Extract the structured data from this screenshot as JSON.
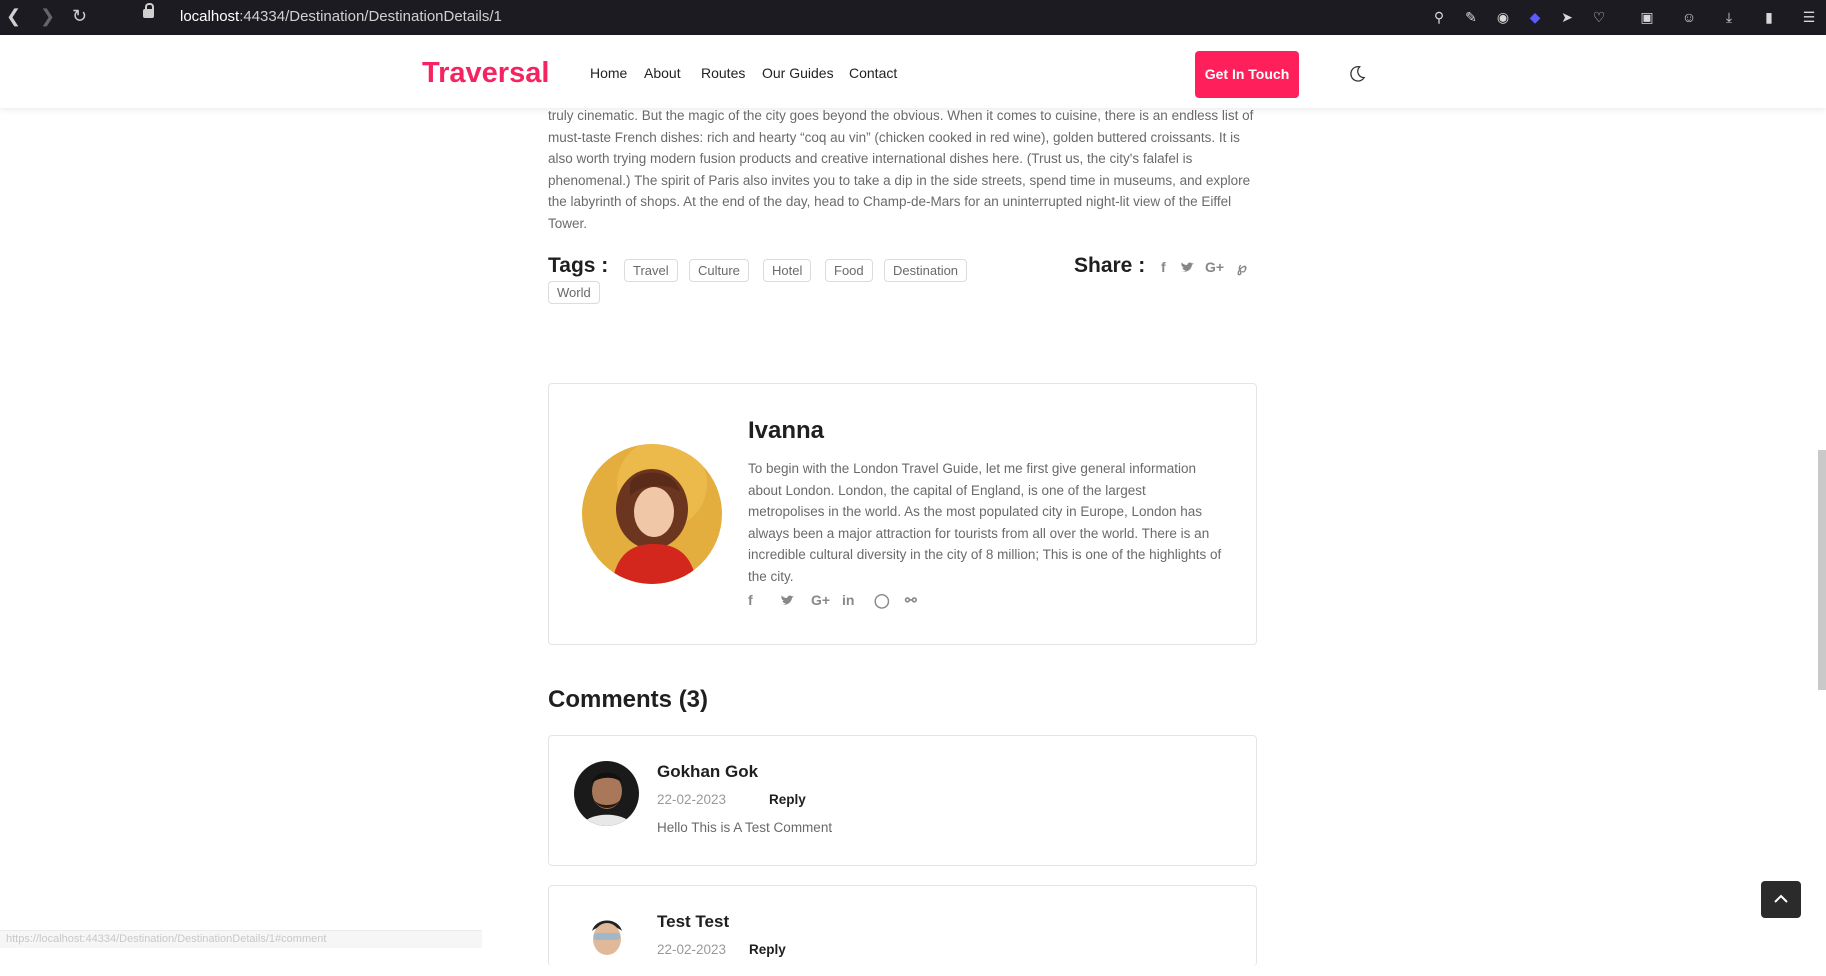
{
  "browser": {
    "url_host": "localhost",
    "url_path": ":44334/Destination/DestinationDetails/1",
    "status_url": "https://localhost:44334/Destination/DestinationDetails/1#comment"
  },
  "header": {
    "logo": "Traversal",
    "menu": [
      "Home",
      "About",
      "Routes",
      "Our Guides",
      "Contact"
    ],
    "cta": "Get In Touch"
  },
  "article": {
    "text": "truly cinematic. But the magic of the city goes beyond the obvious. When it comes to cuisine, there is an endless list of must-taste French dishes: rich and hearty “coq au vin” (chicken cooked in red wine), golden buttered croissants. It is also worth trying modern fusion products and creative international dishes here. (Trust us, the city's falafel is phenomenal.) The spirit of Paris also invites you to take a dip in the side streets, spend time in museums, and explore the labyrinth of shops. At the end of the day, head to Champ-de-Mars for an uninterrupted night-lit view of the Eiffel Tower."
  },
  "tags": {
    "title": "Tags :",
    "items": [
      "Travel",
      "Culture",
      "Hotel",
      "Food",
      "Destination",
      "World"
    ]
  },
  "share": {
    "title": "Share :",
    "icons": [
      "facebook-icon",
      "twitter-icon",
      "google-plus-icon",
      "pinterest-icon"
    ]
  },
  "author": {
    "name": "Ivanna",
    "bio": "To begin with the London Travel Guide, let me first give general information about London. London, the capital of England, is one of the largest metropolises in the world. As the most populated city in Europe, London has always been a major attraction for tourists from all over the world. There is an incredible cultural diversity in the city of 8 million; This is one of the highlights of the city.",
    "social_icons": [
      "facebook-icon",
      "twitter-icon",
      "google-plus-icon",
      "linkedin-icon",
      "github-icon",
      "dribbble-icon"
    ]
  },
  "comments": {
    "title": "Comments (3)",
    "items": [
      {
        "name": "Gokhan Gok",
        "date": "22-02-2023",
        "reply": "Reply",
        "text": "Hello This is A Test Comment"
      },
      {
        "name": "Test Test",
        "date": "22-02-2023",
        "reply": "Reply",
        "text": ""
      }
    ]
  },
  "colors": {
    "brand": "#f5235f",
    "cta_bg": "#ff1f5a",
    "browser_bar": "#1c1b22"
  }
}
